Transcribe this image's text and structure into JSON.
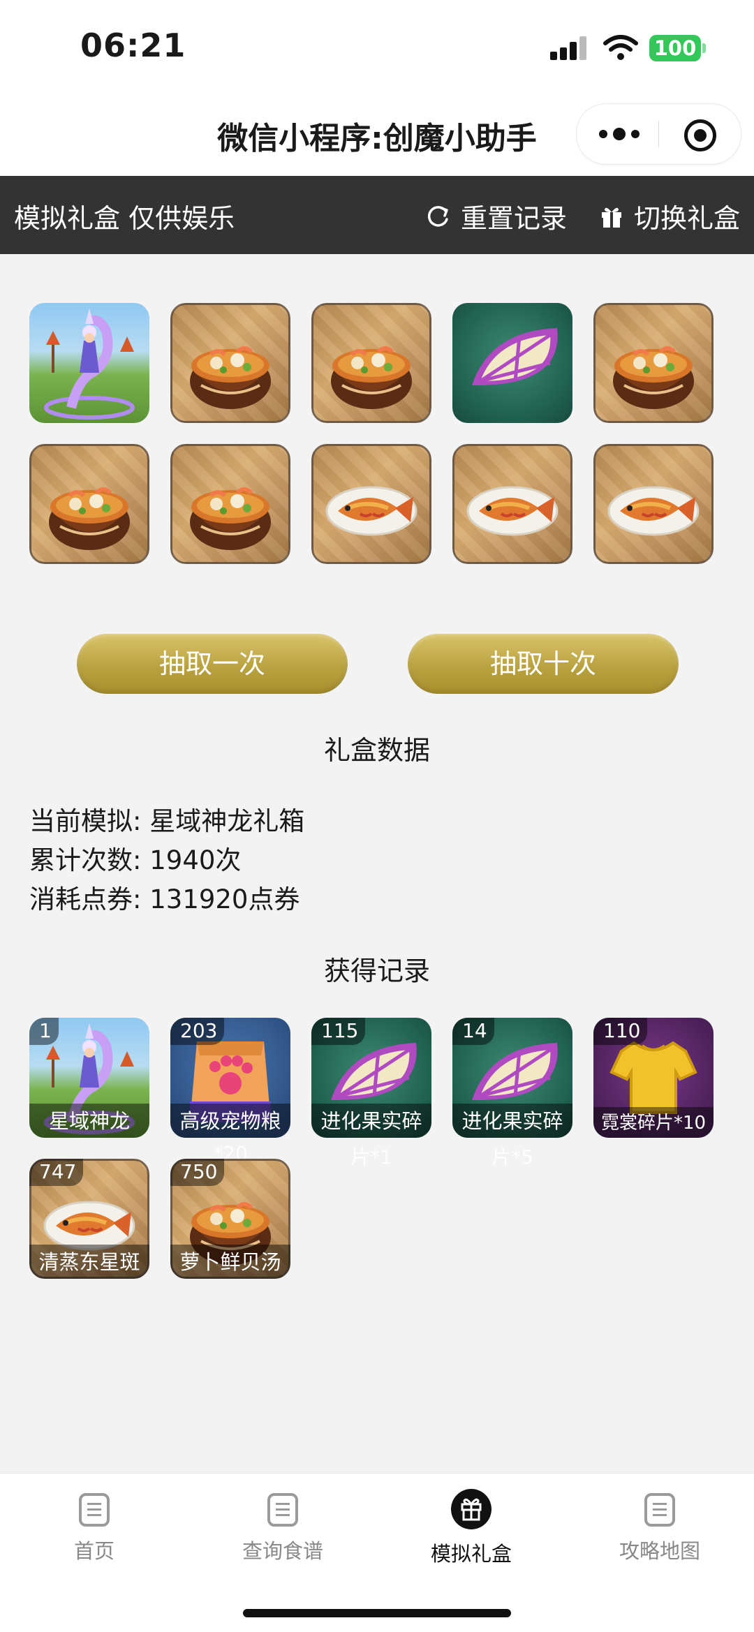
{
  "status_bar": {
    "time": "06:21",
    "battery": "100"
  },
  "navbar": {
    "title": "微信小程序:创魔小助手"
  },
  "toolbar": {
    "title": "模拟礼盒 仅供娱乐",
    "reset_label": "重置记录",
    "switch_label": "切换礼盒"
  },
  "draw_results": [
    {
      "icon": "dragon-mount-icon"
    },
    {
      "icon": "shellfish-soup-icon"
    },
    {
      "icon": "shellfish-soup-icon"
    },
    {
      "icon": "evolution-fruit-slice-icon"
    },
    {
      "icon": "shellfish-soup-icon"
    },
    {
      "icon": "shellfish-soup-icon"
    },
    {
      "icon": "shellfish-soup-icon"
    },
    {
      "icon": "steamed-fish-icon"
    },
    {
      "icon": "steamed-fish-icon"
    },
    {
      "icon": "steamed-fish-icon"
    }
  ],
  "buttons": {
    "draw_once": "抽取一次",
    "draw_ten": "抽取十次"
  },
  "stats": {
    "heading": "礼盒数据",
    "current_label": "当前模拟:",
    "current_value": "星域神龙礼箱",
    "count_label": "累计次数:",
    "count_value": "1940次",
    "cost_label": "消耗点券:",
    "cost_value": "131920点券"
  },
  "records": {
    "heading": "获得记录",
    "items": [
      {
        "count": "1",
        "label": "星域神龙",
        "icon": "dragon-mount-icon"
      },
      {
        "count": "203",
        "label": "高级宠物粮",
        "overflow": "*20",
        "icon": "pet-food-bag-icon"
      },
      {
        "count": "115",
        "label": "进化果实碎",
        "overflow": "片*1",
        "icon": "evolution-fruit-slice-icon"
      },
      {
        "count": "14",
        "label": "进化果实碎",
        "overflow": "片*5",
        "icon": "evolution-fruit-slice-icon"
      },
      {
        "count": "110",
        "label": "霓裳碎片*10",
        "icon": "golden-shirt-icon"
      },
      {
        "count": "747",
        "label": "清蒸东星斑",
        "icon": "steamed-fish-icon"
      },
      {
        "count": "750",
        "label": "萝卜鲜贝汤",
        "icon": "shellfish-soup-icon"
      }
    ]
  },
  "tabbar": {
    "items": [
      {
        "label": "首页",
        "active": false
      },
      {
        "label": "查询食谱",
        "active": false
      },
      {
        "label": "模拟礼盒",
        "active": true
      },
      {
        "label": "攻略地图",
        "active": false
      }
    ]
  },
  "colors": {
    "toolbar_bg": "#333333",
    "gold_button": "#bfa444",
    "battery": "#34c759"
  }
}
